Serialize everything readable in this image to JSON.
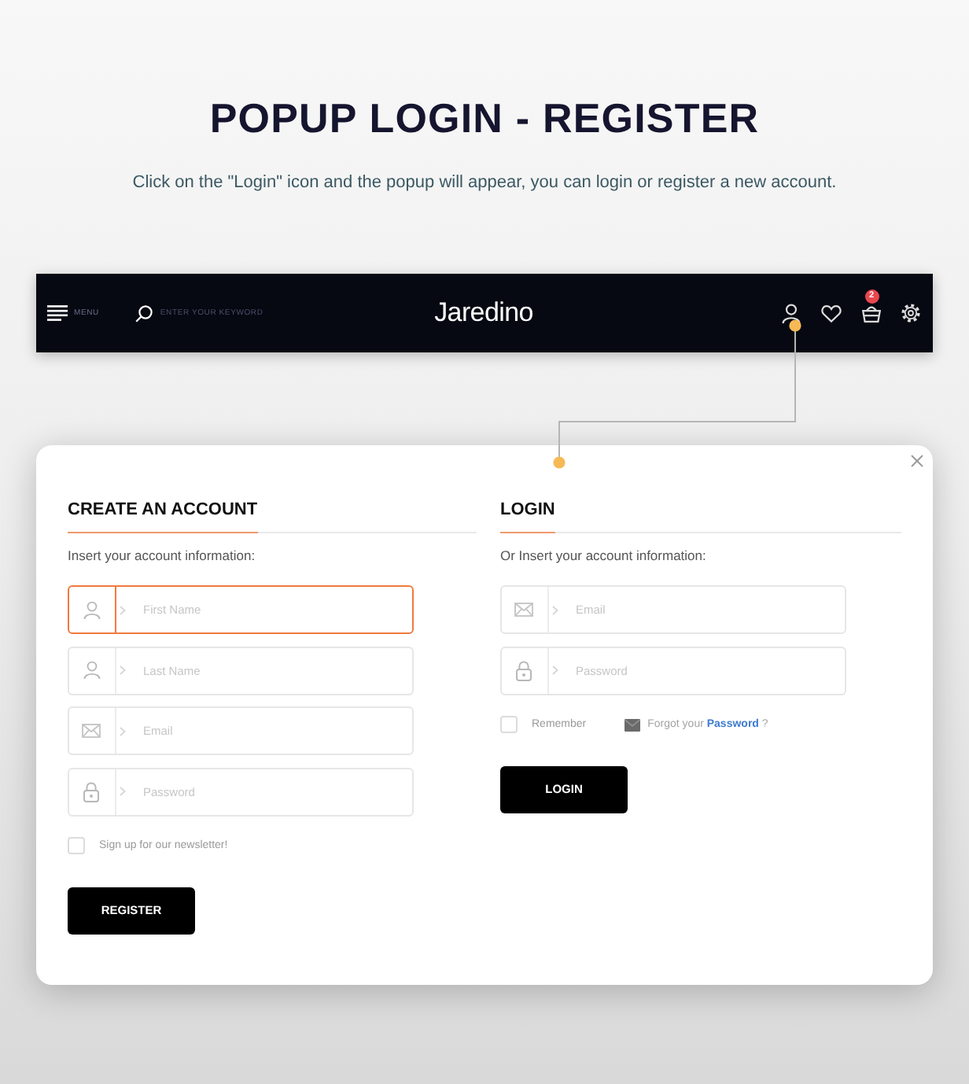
{
  "intro": {
    "title": "POPUP LOGIN - REGISTER",
    "subtitle": "Click on the \"Login\" icon and the popup will appear, you can login or register a new account."
  },
  "header": {
    "menu_label": "MENU",
    "search": {
      "placeholder": "ENTER YOUR KEYWORD"
    },
    "logo": "Jaredino",
    "actions": [
      {
        "kind": "user"
      },
      {
        "kind": "heart"
      },
      {
        "kind": "basket",
        "badge": "2"
      },
      {
        "kind": "settings"
      }
    ]
  },
  "popup": {
    "register": {
      "title": "CREATE AN ACCOUNT",
      "intro": "Insert your account information:",
      "fields": [
        {
          "kind": "user",
          "placeholder": "First Name",
          "focused": true
        },
        {
          "kind": "user",
          "placeholder": "Last Name",
          "focused": false
        },
        {
          "kind": "email",
          "placeholder": "Email",
          "focused": false
        },
        {
          "kind": "password",
          "placeholder": "Password",
          "focused": false
        }
      ],
      "newsletter": {
        "label": "Sign up for our newsletter!",
        "checked": false
      },
      "button": "REGISTER"
    },
    "login": {
      "title": "LOGIN",
      "intro": "Or Insert your account information:",
      "fields": [
        {
          "kind": "email",
          "placeholder": "Email",
          "focused": false
        },
        {
          "kind": "password",
          "placeholder": "Password",
          "focused": false
        }
      ],
      "remember": {
        "label": "Remember",
        "checked": false
      },
      "forgot": {
        "text": "Forgot your",
        "link": "Password",
        "suffix": "?"
      },
      "button": "LOGIN"
    }
  }
}
